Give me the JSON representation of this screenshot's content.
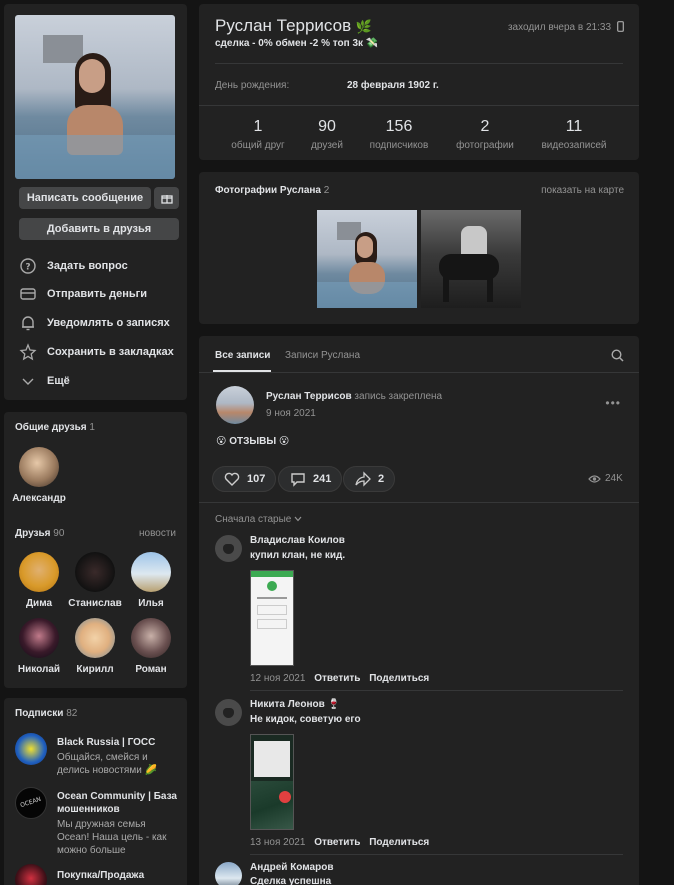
{
  "profile": {
    "name": "Руслан Террисов",
    "name_emoji": "🌿",
    "status": "сделка - 0% обмен -2 % топ 3к",
    "status_emoji": "💸",
    "last_seen": "заходил вчера в 21:33",
    "birthday_label": "День рождения:",
    "birthday_value": "28 февраля 1902 г."
  },
  "stats": [
    {
      "n": "1",
      "l": "общий друг"
    },
    {
      "n": "90",
      "l": "друзей"
    },
    {
      "n": "156",
      "l": "подписчиков"
    },
    {
      "n": "2",
      "l": "фотографии"
    },
    {
      "n": "11",
      "l": "видеозаписей"
    }
  ],
  "actions": {
    "message": "Написать сообщение",
    "add_friend": "Добавить в друзья"
  },
  "menu": [
    "Задать вопрос",
    "Отправить деньги",
    "Уведомлять о записях",
    "Сохранить в закладках",
    "Ещё"
  ],
  "common_friends": {
    "title": "Общие друзья",
    "count": "1",
    "name": "Александр"
  },
  "friends": {
    "title": "Друзья",
    "count": "90",
    "link": "новости",
    "names": [
      "Дима",
      "Станислав",
      "Илья",
      "Николай",
      "Кирилл",
      "Роман"
    ]
  },
  "subs": {
    "title": "Подписки",
    "count": "82",
    "items": [
      {
        "title": "Black Russia | ГОСС",
        "desc1": "Общайся, смейся и",
        "desc2": "делись новостями 🌽"
      },
      {
        "title": "Ocean Community | База",
        "title2": "мошенников",
        "desc1": "Мы дружная семья",
        "desc2": "Ocean! Наша цель - как",
        "desc3": "можно больше"
      },
      {
        "title": "Покупка/Продажа"
      }
    ]
  },
  "photos": {
    "title": "Фотографии Руслана",
    "count": "2",
    "map": "показать на карте"
  },
  "wall": {
    "tab_all": "Все записи",
    "tab_own": "Записи Руслана",
    "post_author": "Руслан Террисов",
    "post_pinned": "запись закреплена",
    "post_date": "9 ноя 2021",
    "post_text": "😮 ОТЗЫВЫ 😮",
    "likes": "107",
    "comments": "241",
    "shares": "2",
    "views": "24K",
    "sort": "Сначала старые"
  },
  "comments": [
    {
      "name": "Владислав Коилов",
      "text": "купил клан, не кид.",
      "date": "12 ноя 2021",
      "reply": "Ответить",
      "share": "Поделиться"
    },
    {
      "name": "Никита Леонов 🍷",
      "text": "Не кидок, советую его",
      "date": "13 ноя 2021",
      "reply": "Ответить",
      "share": "Поделиться"
    },
    {
      "name": "Андрей Комаров",
      "text": "Сделка успешна"
    }
  ]
}
